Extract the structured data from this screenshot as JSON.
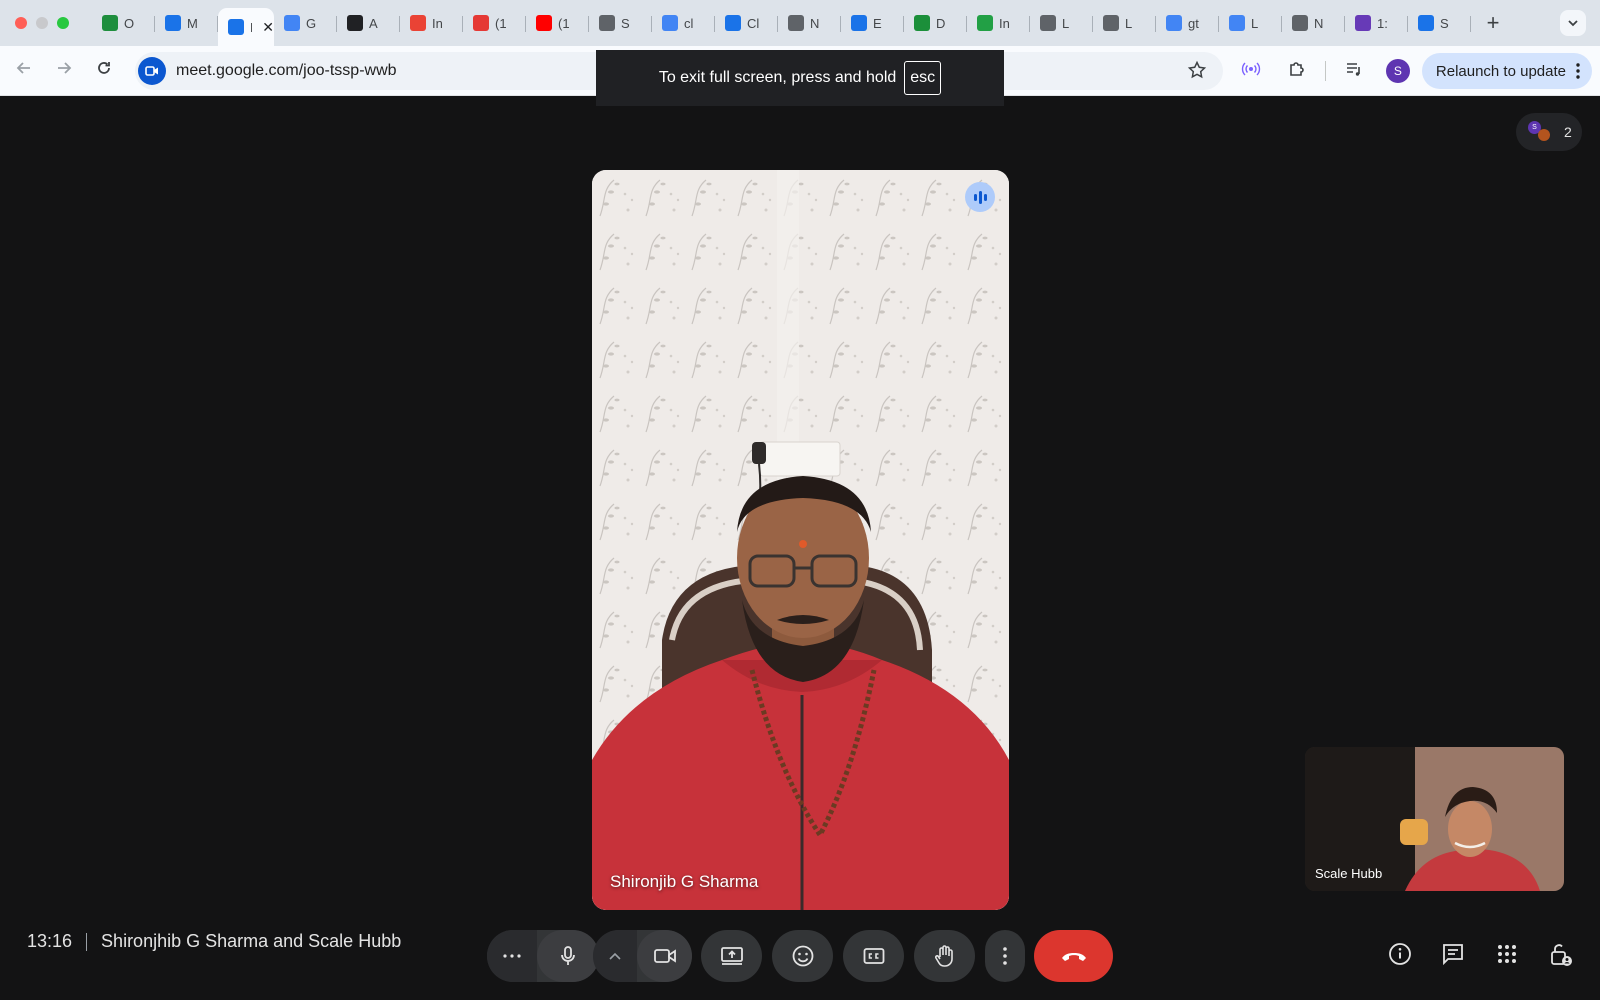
{
  "browser": {
    "tabs": [
      {
        "label": "O",
        "icon": "sheets-icon",
        "color": "#1e8e3e"
      },
      {
        "label": "M",
        "icon": "meet-circle-icon",
        "color": "#1a73e8"
      },
      {
        "label": "M",
        "icon": "meet-icon",
        "color": "#1a73e8",
        "active": true
      },
      {
        "label": "G",
        "icon": "docs-icon",
        "color": "#4285f4"
      },
      {
        "label": "A",
        "icon": "openai-icon",
        "color": "#202124"
      },
      {
        "label": "In",
        "icon": "gmail-icon",
        "color": "#ea4335"
      },
      {
        "label": "(1",
        "icon": "c-icon",
        "color": "#e53935"
      },
      {
        "label": "(1",
        "icon": "youtube-icon",
        "color": "#ff0000"
      },
      {
        "label": "S",
        "icon": "globe-icon",
        "color": "#5f6368"
      },
      {
        "label": "cl",
        "icon": "google-icon",
        "color": "#4285f4"
      },
      {
        "label": "Cl",
        "icon": "chat-icon",
        "color": "#1a73e8"
      },
      {
        "label": "N",
        "icon": "chrome-icon",
        "color": "#5f6368"
      },
      {
        "label": "E",
        "icon": "puzzle-icon",
        "color": "#1a73e8"
      },
      {
        "label": "D",
        "icon": "d-icon",
        "color": "#1b8f3a"
      },
      {
        "label": "In",
        "icon": "f-icon",
        "color": "#22a045"
      },
      {
        "label": "L",
        "icon": "globe-icon",
        "color": "#5f6368"
      },
      {
        "label": "L",
        "icon": "globe-icon",
        "color": "#5f6368"
      },
      {
        "label": "gt",
        "icon": "google-icon",
        "color": "#4285f4"
      },
      {
        "label": "L",
        "icon": "gt-icon",
        "color": "#4285f4"
      },
      {
        "label": "N",
        "icon": "chrome-icon",
        "color": "#5f6368"
      },
      {
        "label": "1:",
        "icon": "forms-icon",
        "color": "#673ab7"
      },
      {
        "label": "S",
        "icon": "settings-icon",
        "color": "#1a73e8"
      }
    ],
    "tab_close": "✕",
    "new_tab": "+",
    "url": "meet.google.com/joo-tssp-wwb",
    "relaunch_label": "Relaunch to update",
    "profile_initial": "S"
  },
  "fullscreen_toast": {
    "message": "To exit full screen, press and hold",
    "key": "esc"
  },
  "meet": {
    "participant_count": "2",
    "participant_avatar_initial": "S",
    "main_speaker": "Shironjib G Sharma",
    "self_view_name": "Scale Hubb",
    "time": "13:16",
    "meeting_title": "Shironjhib G Sharma and Scale Hubb",
    "colors": {
      "control_bg": "#333537",
      "end_call": "#dc362e",
      "stage_bg": "#131314",
      "speaking_indicator": "#aecbfa"
    }
  }
}
